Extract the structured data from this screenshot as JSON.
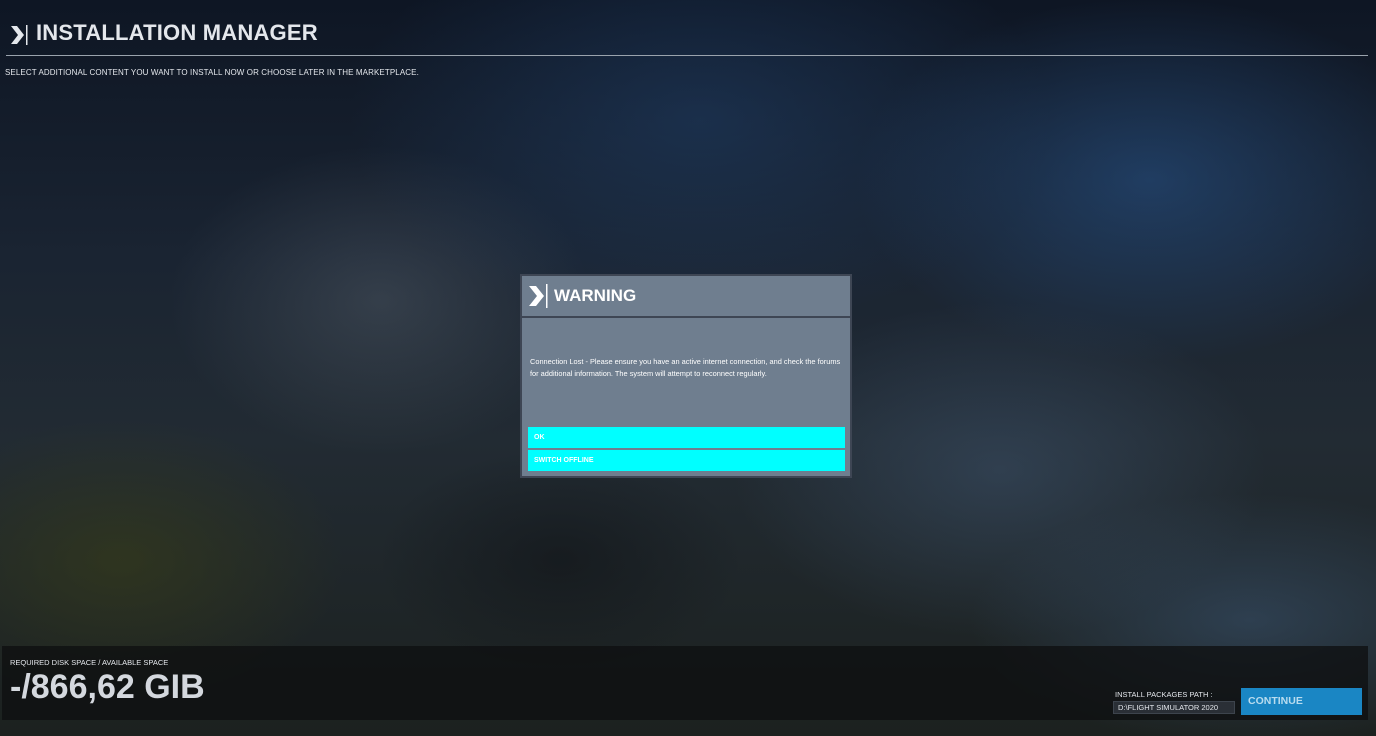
{
  "header": {
    "title": "INSTALLATION MANAGER",
    "subtitle": "SELECT ADDITIONAL CONTENT YOU WANT TO INSTALL NOW OR CHOOSE LATER IN THE MARKETPLACE."
  },
  "dialog": {
    "title": "WARNING",
    "message": "Connection Lost - Please ensure you have an active internet connection, and check the forums for additional information. The system will attempt to reconnect regularly.",
    "buttons": {
      "ok": "OK",
      "switch_offline": "SWITCH OFFLINE"
    }
  },
  "footer": {
    "space_label": "REQUIRED DISK SPACE / AVAILABLE SPACE",
    "space_value": "-/866,62 GIB",
    "path_label": "INSTALL PACKAGES PATH :",
    "path_value": "D:\\FLIGHT SIMULATOR 2020",
    "continue_label": "CONTINUE"
  },
  "icons": {
    "header": "chevron-right-icon",
    "dialog": "chevron-right-icon"
  },
  "colors": {
    "dialog_button": "#00ffff",
    "continue_button": "#1a86c4",
    "dialog_panel": "#6f7e8f"
  }
}
